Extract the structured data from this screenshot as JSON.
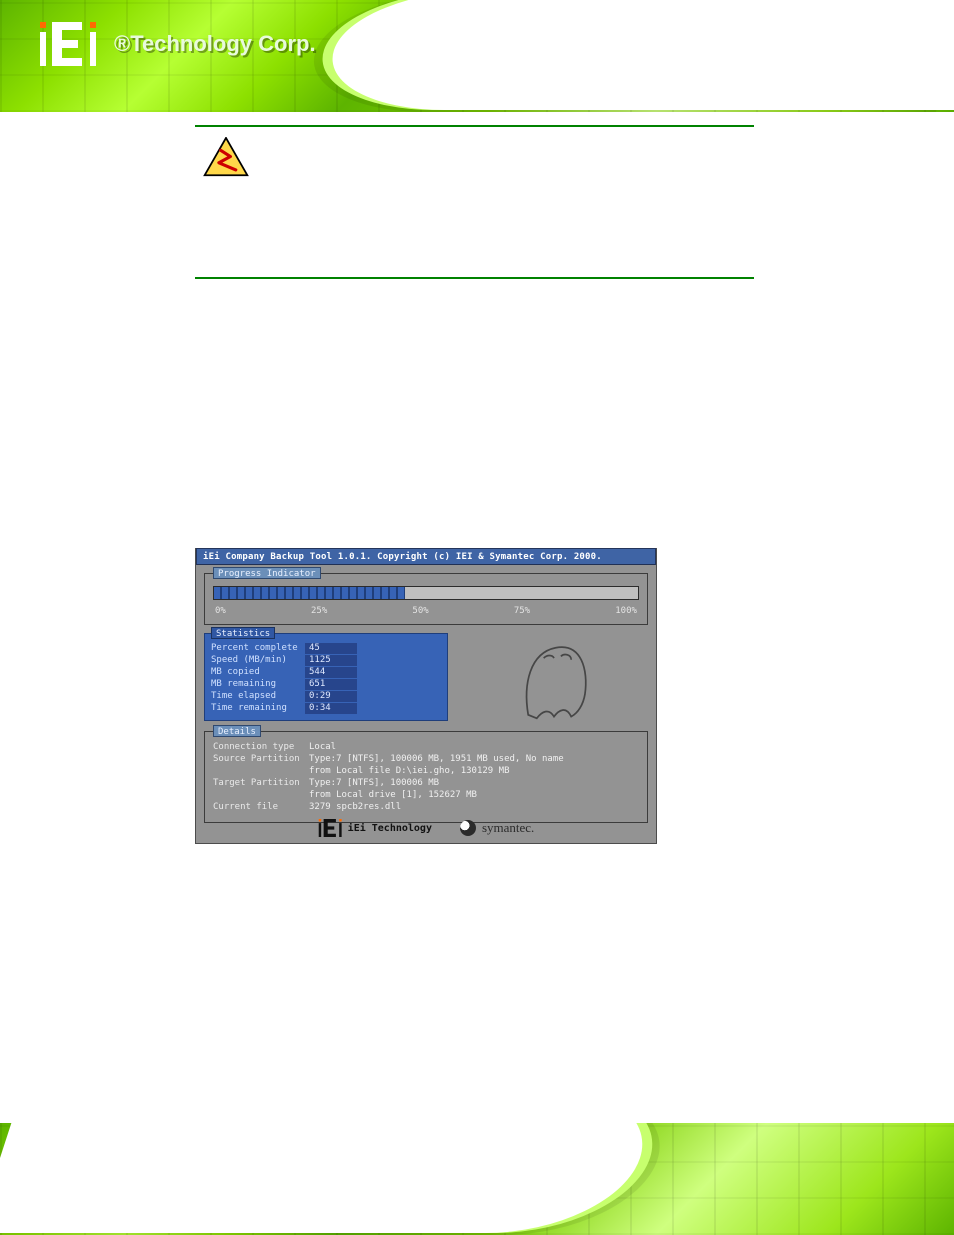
{
  "brand": {
    "name": "iEi",
    "tagline": "®Technology Corp."
  },
  "ghost": {
    "title": "iEi Company Backup Tool 1.0.1.  Copyright (c) IEI & Symantec Corp. 2000.",
    "progress": {
      "label": "Progress Indicator",
      "marks": {
        "p0": "0%",
        "p25": "25%",
        "p50": "50%",
        "p75": "75%",
        "p100": "100%"
      },
      "percent": 45
    },
    "statistics": {
      "label": "Statistics",
      "rows": {
        "percent_complete": {
          "label": "Percent complete",
          "value": "45"
        },
        "speed": {
          "label": "Speed (MB/min)",
          "value": "1125"
        },
        "mb_copied": {
          "label": "MB copied",
          "value": "544"
        },
        "mb_remaining": {
          "label": "MB remaining",
          "value": "651"
        },
        "time_elapsed": {
          "label": "Time elapsed",
          "value": "0:29"
        },
        "time_remaining": {
          "label": "Time remaining",
          "value": "0:34"
        }
      }
    },
    "details": {
      "label": "Details",
      "connection_type": {
        "label": "Connection type",
        "value": "Local"
      },
      "source": {
        "label": "Source Partition",
        "value1": "Type:7 [NTFS], 100006 MB, 1951 MB used, No name",
        "value2": "from Local file D:\\iei.gho, 130129 MB"
      },
      "target": {
        "label": "Target Partition",
        "value1": "Type:7 [NTFS], 100006 MB",
        "value2": "from Local drive [1], 152627 MB"
      },
      "current_file": {
        "label": "Current file",
        "value": "3279 spcb2res.dll"
      }
    },
    "footer": {
      "iei_text": "iEi Technology",
      "sym_text": "symantec."
    }
  }
}
